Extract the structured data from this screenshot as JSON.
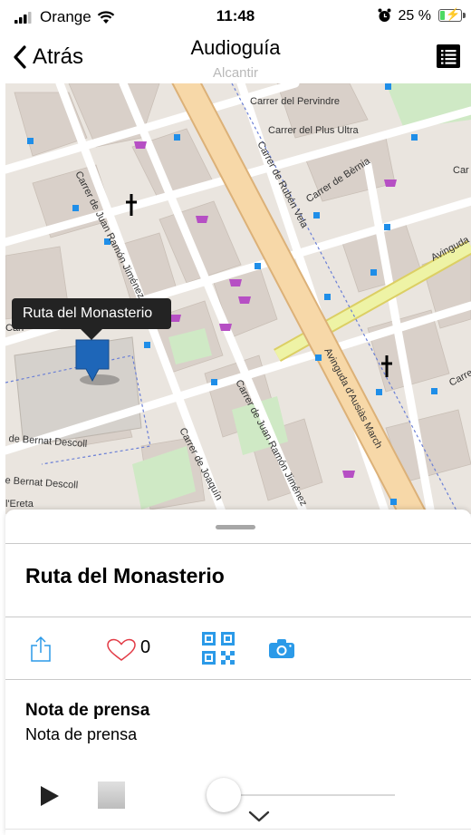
{
  "status_bar": {
    "carrier": "Orange",
    "time": "11:48",
    "battery_percent": "25 %",
    "battery_level": 0.25
  },
  "nav": {
    "back_label": "Atrás",
    "title": "Audioguía",
    "subtitle": "Alcantir"
  },
  "map": {
    "streets": [
      "Carrer del Pervindre",
      "Carrer del Plus Ultra",
      "Carrer de Juan Ramón Jiménez",
      "Carrer de Rubén Vela",
      "Carrer de Bèrnia",
      "Avinguda d'Ausiàs March",
      "Avinguda",
      "Car",
      "de Bernat Descoll",
      "e Bernat Descoll",
      "Carrer de Joaquín",
      "Carrer de Juan Ramón Jiménez",
      "Carre",
      "l'Ereta",
      "Carr"
    ],
    "marker_callout": "Ruta del Monasterio",
    "colors": {
      "background": "#eae5df",
      "building": "#d9d0c9",
      "avenue": "#f7d8a8",
      "avenue_border": "#dcb178",
      "green": "#cfe9c5",
      "cycle_way": "#eef3a5",
      "marker": "#1e66b8",
      "poi": "#1f8ee8",
      "shop": "#b64fc4"
    }
  },
  "sheet": {
    "route_title": "Ruta del Monasterio",
    "likes": "0",
    "press_title": "Nota de prensa",
    "press_text": "Nota de prensa",
    "audio_progress": 0.0,
    "icons": {
      "share": "share-icon",
      "like": "heart-icon",
      "qr": "qr-code-icon",
      "camera": "camera-icon",
      "play": "play-icon",
      "stop": "stop-icon",
      "collapse": "chevron-down-icon"
    },
    "accent": "#2b9ae8"
  }
}
